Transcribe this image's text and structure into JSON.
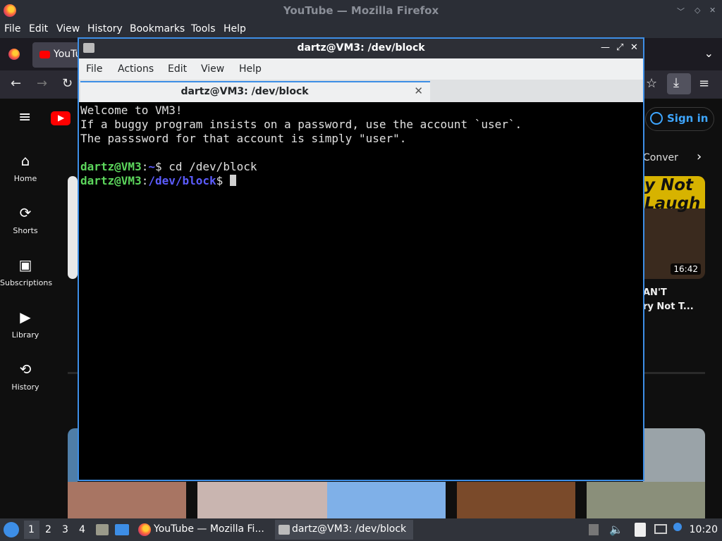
{
  "firefox": {
    "window_title": "YouTube — Mozilla Firefox",
    "menu": [
      "File",
      "Edit",
      "View",
      "History",
      "Bookmarks",
      "Tools",
      "Help"
    ],
    "tab_label": "YouTu"
  },
  "youtube": {
    "sidebar": [
      {
        "label": "Home",
        "icon": "home-icon"
      },
      {
        "label": "Shorts",
        "icon": "shorts-icon"
      },
      {
        "label": "Subscriptions",
        "icon": "subscriptions-icon"
      },
      {
        "label": "Library",
        "icon": "library-icon"
      },
      {
        "label": "History",
        "icon": "history-icon"
      }
    ],
    "sign_in": "Sign in",
    "chip_partial": "Conver",
    "thumb_duration": "16:42",
    "thumb_overlay_text": "y Not\nLaugh",
    "video_title_partial_1": "AN'T",
    "video_title_partial_2": "ry Not T..."
  },
  "terminal": {
    "window_title": "dartz@VM3: /dev/block",
    "menu": [
      "File",
      "Actions",
      "Edit",
      "View",
      "Help"
    ],
    "tab_title": "dartz@VM3: /dev/block",
    "lines": {
      "l1": "Welcome to VM3!",
      "l2": "If a buggy program insists on a password, use the account `user`.",
      "l3": "The passsword for that account is simply \"user\".",
      "p1_user": "dartz@VM3",
      "p1_path": "~",
      "p1_cmd": "$ cd /dev/block",
      "p2_user": "dartz@VM3",
      "p2_path": "/dev/block",
      "p2_cmd": "$ "
    }
  },
  "taskbar": {
    "desktops": [
      "1",
      "2",
      "3",
      "4"
    ],
    "firefox_task": "YouTube — Mozilla Fi...",
    "terminal_task": "dartz@VM3: /dev/block",
    "clock": "10:20"
  }
}
